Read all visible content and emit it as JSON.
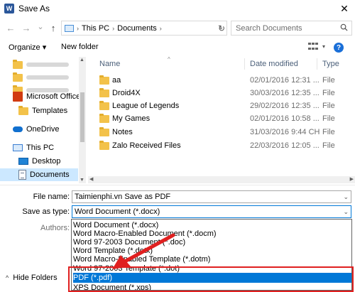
{
  "window": {
    "title": "Save As",
    "app_icon_letter": "W",
    "close_glyph": "✕"
  },
  "nav": {
    "back_glyph": "←",
    "forward_glyph": "→",
    "recent_glyph": "⌄",
    "up_glyph": "↑",
    "breadcrumb": [
      "This PC",
      "Documents"
    ],
    "refresh_glyph": "↻",
    "search_placeholder": "Search Documents"
  },
  "toolbar": {
    "organize_label": "Organize ▾",
    "new_folder_label": "New folder",
    "help_glyph": "?"
  },
  "sidebar": {
    "items": [
      {
        "label": "",
        "icon": "folder-icon",
        "blurred": true
      },
      {
        "label": "",
        "icon": "folder-icon",
        "blurred": true
      },
      {
        "label": "",
        "icon": "folder-icon",
        "blurred": true
      },
      {
        "label": "Microsoft Office",
        "icon": "office-icon"
      },
      {
        "label": "Templates",
        "icon": "folder-icon"
      },
      {
        "label": "OneDrive",
        "icon": "cloud-icon"
      },
      {
        "label": "This PC",
        "icon": "computer-icon"
      },
      {
        "label": "Desktop",
        "icon": "desktop-icon"
      },
      {
        "label": "Documents",
        "icon": "documents-icon",
        "selected": true
      }
    ]
  },
  "filelist": {
    "columns": [
      "Name",
      "Date modified",
      "Type"
    ],
    "rows": [
      {
        "name": "aa",
        "date": "02/01/2016 12:31 ...",
        "type": "File"
      },
      {
        "name": "Droid4X",
        "date": "30/03/2016 12:35 ...",
        "type": "File"
      },
      {
        "name": "League of Legends",
        "date": "29/02/2016 12:35 ...",
        "type": "File"
      },
      {
        "name": "My Games",
        "date": "02/01/2016 10:58 ...",
        "type": "File"
      },
      {
        "name": "Notes",
        "date": "31/03/2016 9:44 CH",
        "type": "File"
      },
      {
        "name": "Zalo Received Files",
        "date": "22/03/2016 12:05 ...",
        "type": "File"
      }
    ]
  },
  "form": {
    "file_name_label": "File name:",
    "file_name_value": "Taimienphi.vn Save as PDF",
    "save_type_label": "Save as type:",
    "save_type_value": "Word Document (*.docx)",
    "authors_label": "Authors:"
  },
  "type_options": [
    "Word Document (*.docx)",
    "Word Macro-Enabled Document (*.docm)",
    "Word 97-2003 Document (*.doc)",
    "Word Template (*.dotx)",
    "Word Macro-Enabled Template (*.dotm)",
    "Word 97-2003 Template (*.dot)",
    "PDF (*.pdf)",
    "XPS Document (*.xps)"
  ],
  "selected_option_index": 6,
  "hide_folders_label": "Hide Folders",
  "colors": {
    "selection": "#0078d7",
    "highlight_box": "#e02020",
    "arrow": "#e02020"
  }
}
